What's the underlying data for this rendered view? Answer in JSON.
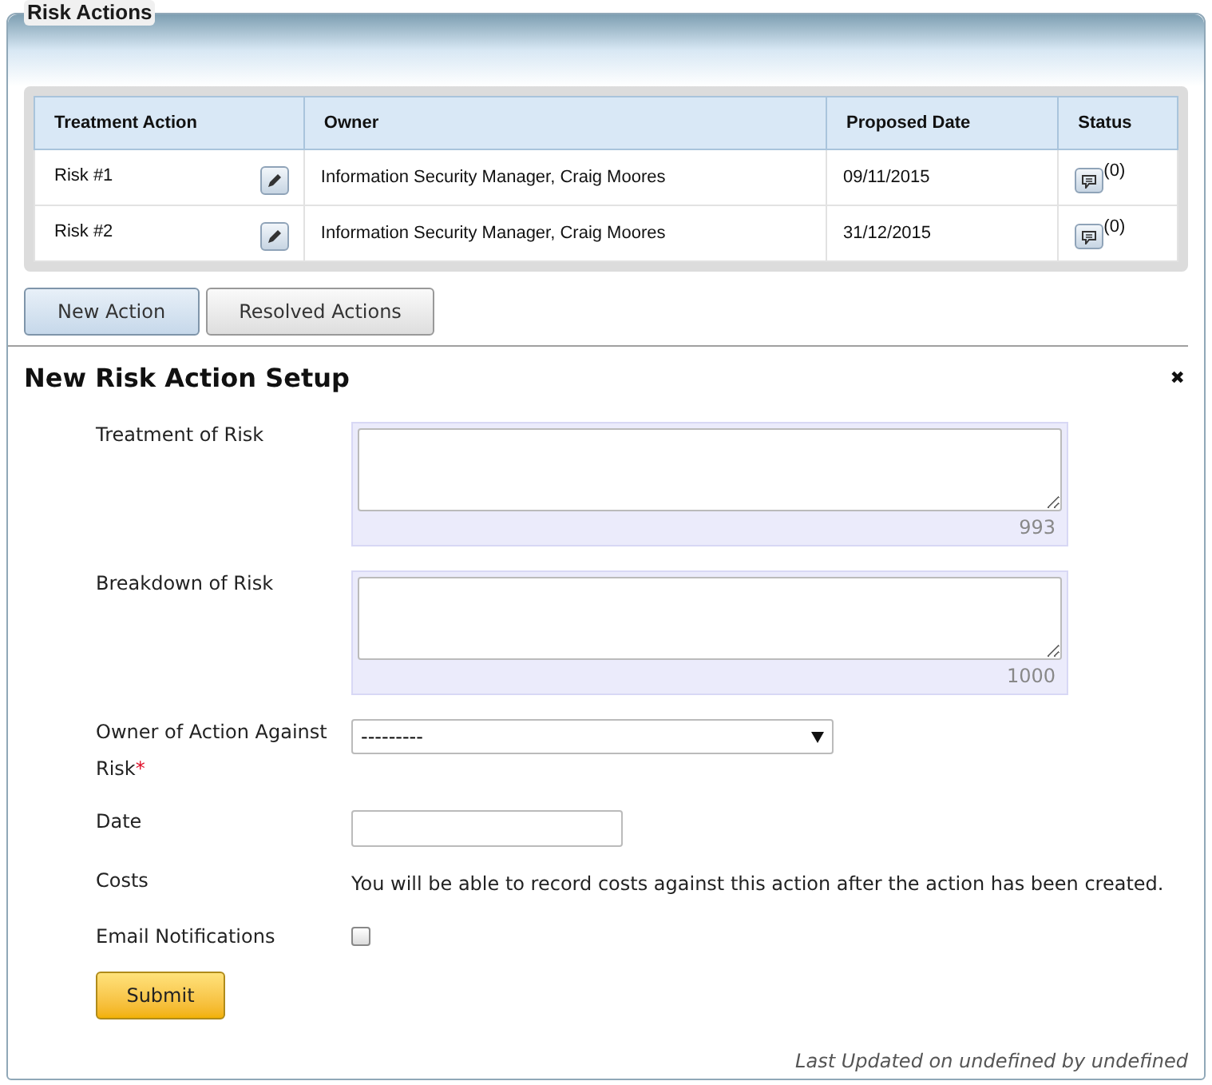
{
  "panel": {
    "title": "Risk Actions"
  },
  "table": {
    "columns": [
      "Treatment Action",
      "Owner",
      "Proposed Date",
      "Status"
    ],
    "rows": [
      {
        "action": "Risk #1",
        "owner": "Information Security Manager, Craig Moores",
        "date": "09/11/2015",
        "comments": "(0)"
      },
      {
        "action": "Risk #2",
        "owner": "Information Security Manager, Craig Moores",
        "date": "31/12/2015",
        "comments": "(0)"
      }
    ]
  },
  "tabs": [
    {
      "label": "New Action",
      "selected": true
    },
    {
      "label": "Resolved Actions",
      "selected": false
    }
  ],
  "form": {
    "title": "New Risk Action Setup",
    "close": "✖",
    "fields": [
      {
        "kind": "textarea",
        "label": "Treatment of Risk",
        "counter": "993"
      },
      {
        "kind": "textarea",
        "label": "Breakdown of Risk",
        "counter": "1000"
      },
      {
        "kind": "select",
        "label": "Owner of Action Against Risk",
        "required_mark": "*",
        "value": "---------"
      },
      {
        "kind": "input",
        "label": "Date"
      },
      {
        "kind": "note",
        "label": "Costs",
        "text": "You will be able to record costs against this action after the action has been created."
      },
      {
        "kind": "checkbox",
        "label": "Email Notifications",
        "checked": false
      }
    ],
    "submit": "Submit",
    "footer": "Last Updated on undefined by undefined"
  }
}
